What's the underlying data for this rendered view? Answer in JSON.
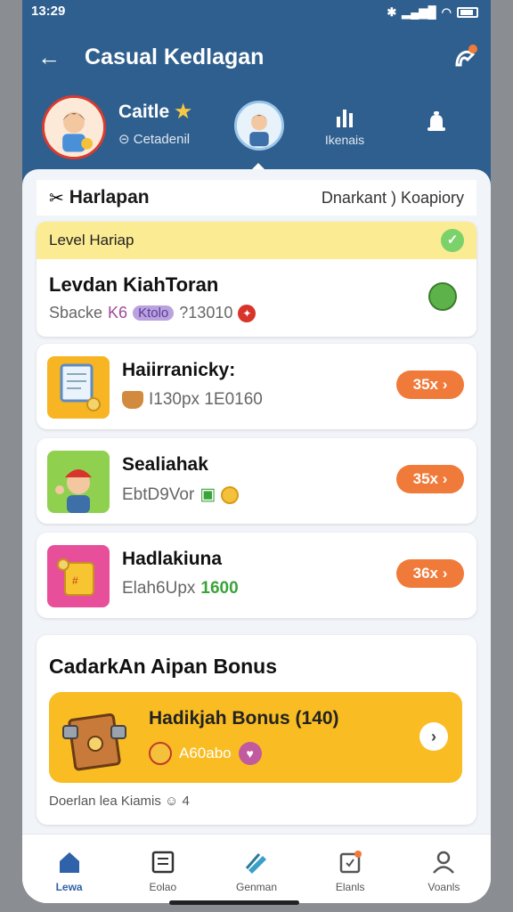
{
  "status_bar": {
    "time": "13:29",
    "icons": [
      "bluetooth-icon",
      "signal-icon",
      "wifi-icon",
      "battery-icon"
    ]
  },
  "appbar": {
    "title": "Casual Kedlagan"
  },
  "profile": {
    "name": "Caitle",
    "subtitle": "Cetadenil",
    "stats": [
      {
        "label": "Ikenais"
      }
    ]
  },
  "section": {
    "title": "Harlapan",
    "right_text": "Dnarkant )  Koapiory"
  },
  "level_card": {
    "strip_label": "Level Hariap",
    "name": "Levdan KiahToran",
    "meta_prefix": "Sbacke",
    "meta_code": "K6",
    "meta_pill": "Ktolo",
    "meta_value": "?13010"
  },
  "items": [
    {
      "title": "Haiirranicky:",
      "sub": "I130px 1E0160",
      "button": "35x"
    },
    {
      "title": "Sealiahak",
      "sub": "EbtD9Vor",
      "button": "35x"
    },
    {
      "title": "Hadlakiuna",
      "sub": "Elah6Upx",
      "sub_highlight": "1600",
      "button": "36x"
    }
  ],
  "bonus": {
    "title": "CadarkAn Aipan Bonus",
    "box_title": "Hadikjah Bonus (140)",
    "box_sub": "A60abo",
    "footer": "Doerlan lea Kiamis ☺ 4"
  },
  "nav": [
    {
      "label": "Lewa"
    },
    {
      "label": "Eolao"
    },
    {
      "label": "Genman"
    },
    {
      "label": "Elanls"
    },
    {
      "label": "Voanls"
    }
  ],
  "colors": {
    "header": "#2f5f8e",
    "accent_orange": "#f07a3a",
    "bonus_yellow": "#f9bd23",
    "level_strip": "#fbeb92",
    "nav_active": "#2f62a8"
  }
}
